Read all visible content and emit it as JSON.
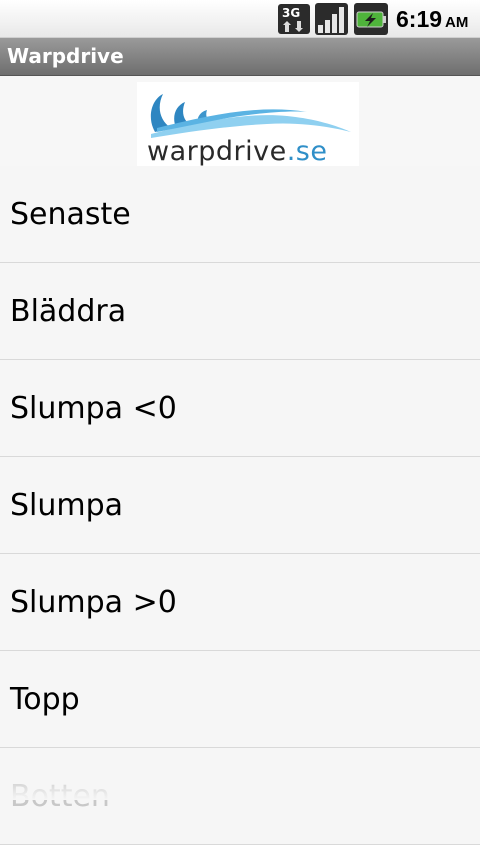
{
  "status_bar": {
    "network_type": "3G",
    "time": "6:19",
    "ampm": "AM",
    "icons": [
      "network-3g-icon",
      "signal-strength-icon",
      "battery-charging-icon"
    ]
  },
  "app": {
    "title": "Warpdrive"
  },
  "logo": {
    "wordmark": "warpdrive",
    "tld": ".se",
    "colors": {
      "wave_dark": "#2e86c1",
      "wave_light": "#8fd0f0",
      "text": "#2a2a2a"
    }
  },
  "menu": {
    "items": [
      {
        "label": "Senaste"
      },
      {
        "label": "Bläddra"
      },
      {
        "label": "Slumpa <0"
      },
      {
        "label": "Slumpa"
      },
      {
        "label": "Slumpa >0"
      },
      {
        "label": "Topp"
      },
      {
        "label": "Botten"
      }
    ]
  },
  "colors": {
    "background": "#f6f6f6",
    "title_bar": "#7a7a7a",
    "divider": "#d9d9d9"
  }
}
